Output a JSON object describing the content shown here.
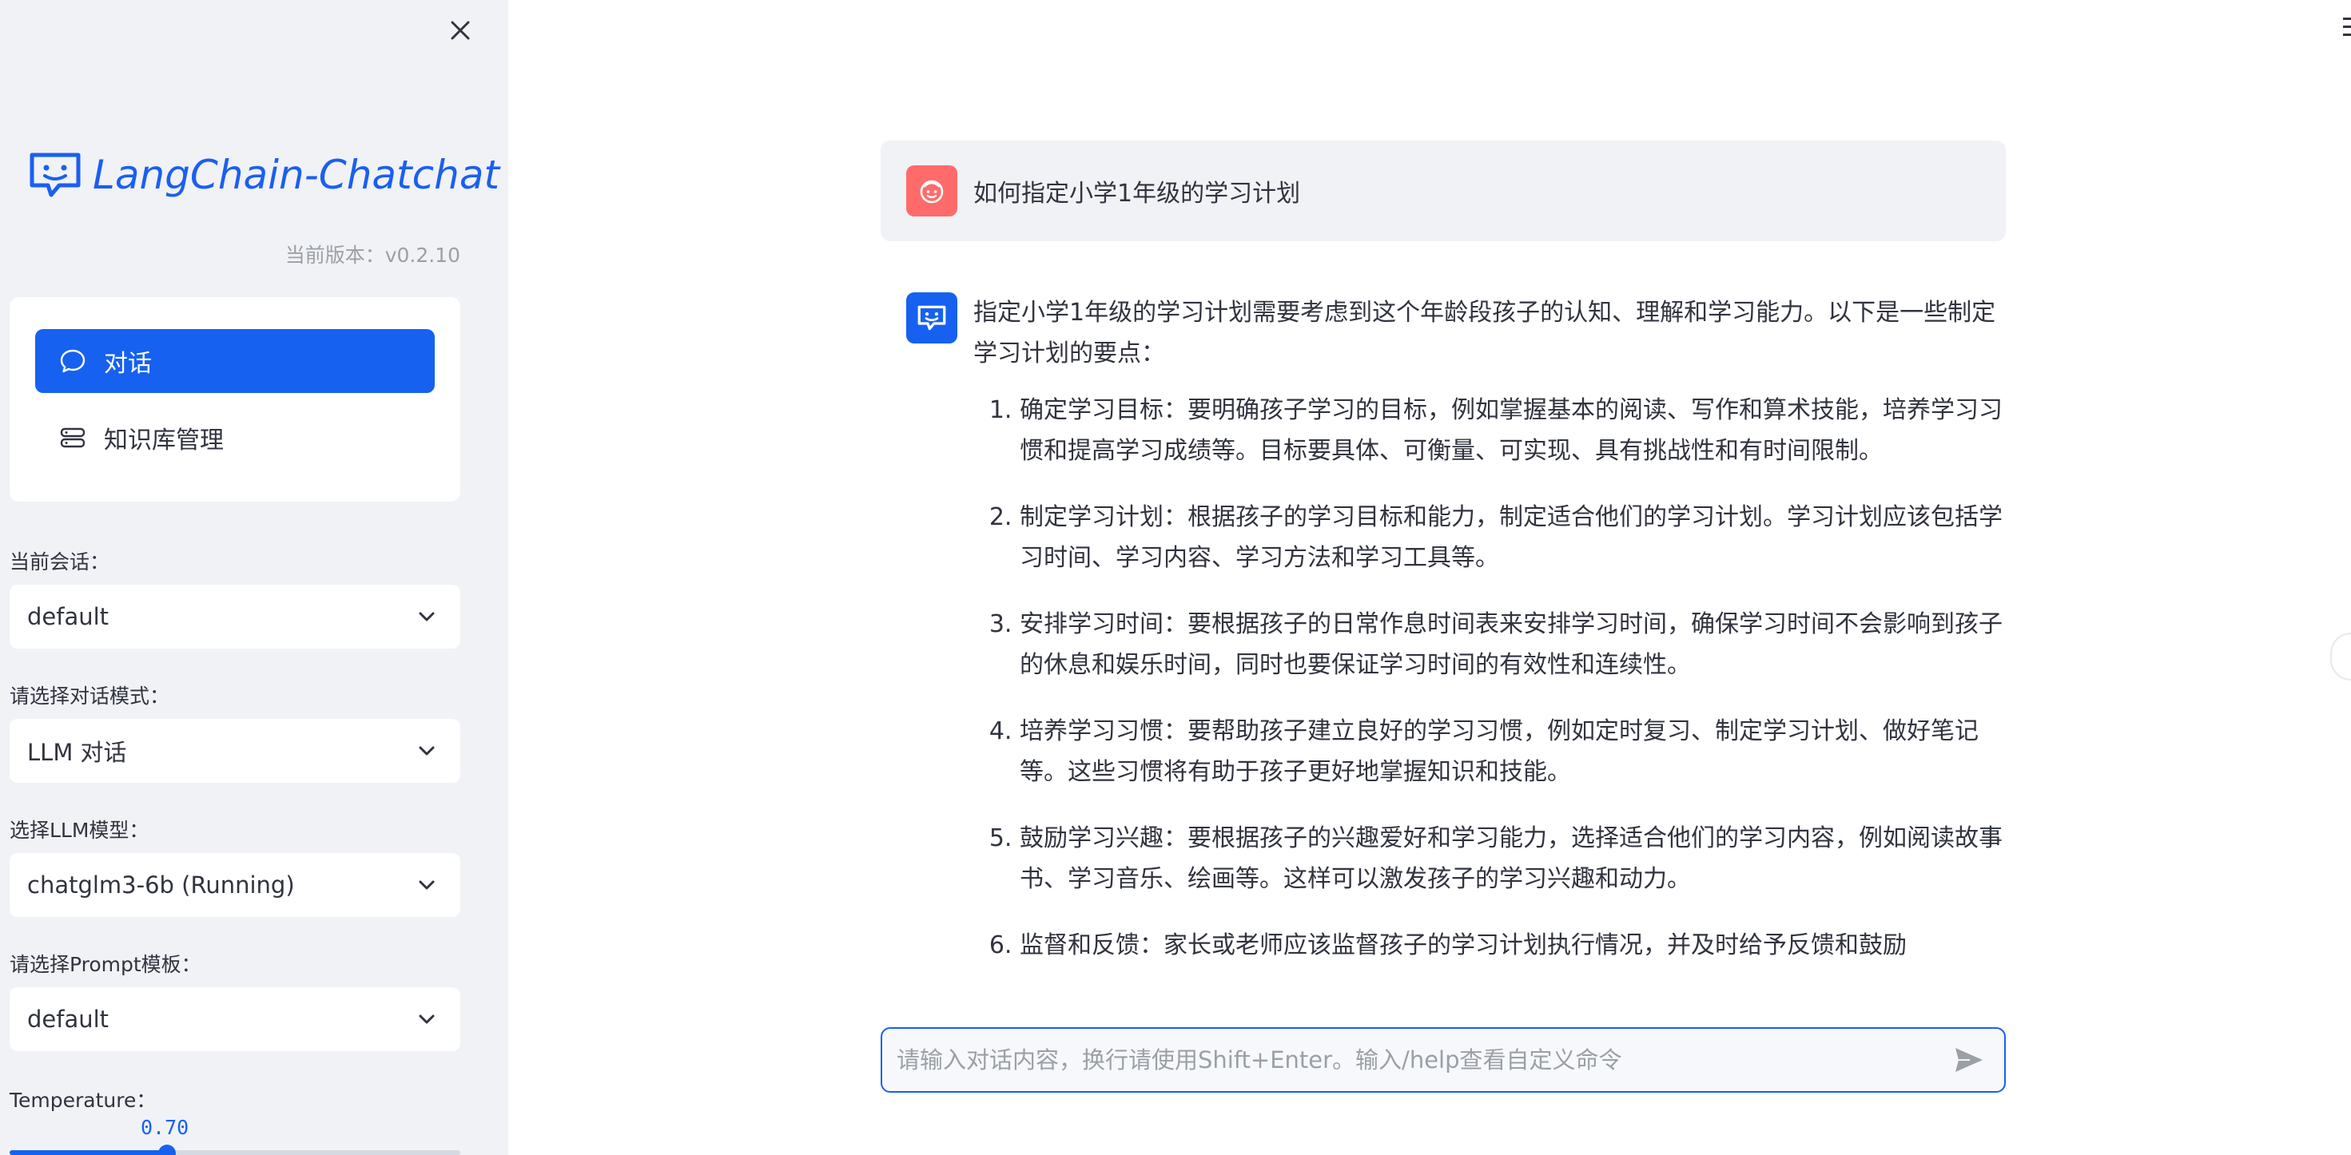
{
  "sidebar": {
    "close_icon": "close-icon",
    "brand": {
      "name": "LangChain-Chatchat",
      "icon": "chat-logo-icon"
    },
    "version": "当前版本：v0.2.10",
    "nav": [
      {
        "label": "对话",
        "icon": "chat-bubble-icon",
        "active": true
      },
      {
        "label": "知识库管理",
        "icon": "database-icon",
        "active": false
      }
    ],
    "session": {
      "label": "当前会话：",
      "value": "default"
    },
    "mode": {
      "label": "请选择对话模式：",
      "value": "LLM 对话"
    },
    "model": {
      "label": "选择LLM模型：",
      "value": "chatglm3-6b (Running)"
    },
    "prompt": {
      "label": "请选择Prompt模板：",
      "value": "default"
    },
    "temperature": {
      "label": "Temperature：",
      "value": "0.70",
      "fraction": 0.35
    }
  },
  "chat": {
    "user_message": "如何指定小学1年级的学习计划",
    "bot_intro": "指定小学1年级的学习计划需要考虑到这个年龄段孩子的认知、理解和学习能力。以下是一些制定学习计划的要点：",
    "bot_points": [
      "确定学习目标：要明确孩子学习的目标，例如掌握基本的阅读、写作和算术技能，培养学习习惯和提高学习成绩等。目标要具体、可衡量、可实现、具有挑战性和有时间限制。",
      "制定学习计划：根据孩子的学习目标和能力，制定适合他们的学习计划。学习计划应该包括学习时间、学习内容、学习方法和学习工具等。",
      "安排学习时间：要根据孩子的日常作息时间表来安排学习时间，确保学习时间不会影响到孩子的休息和娱乐时间，同时也要保证学习时间的有效性和连续性。",
      "培养学习习惯：要帮助孩子建立良好的学习习惯，例如定时复习、制定学习计划、做好笔记等。这些习惯将有助于孩子更好地掌握知识和技能。",
      "鼓励学习兴趣：要根据孩子的兴趣爱好和学习能力，选择适合他们的学习内容，例如阅读故事书、学习音乐、绘画等。这样可以激发孩子的学习兴趣和动力。",
      "监督和反馈：家长或老师应该监督孩子的学习计划执行情况，并及时给予反馈和鼓励"
    ],
    "input_placeholder": "请输入对话内容，换行请使用Shift+Enter。输入/help查看自定义命令",
    "input_value": ""
  },
  "colors": {
    "accent": "#1661f0",
    "sidebar_bg": "#f0f2f6",
    "user_avatar": "#ff6b6b"
  }
}
